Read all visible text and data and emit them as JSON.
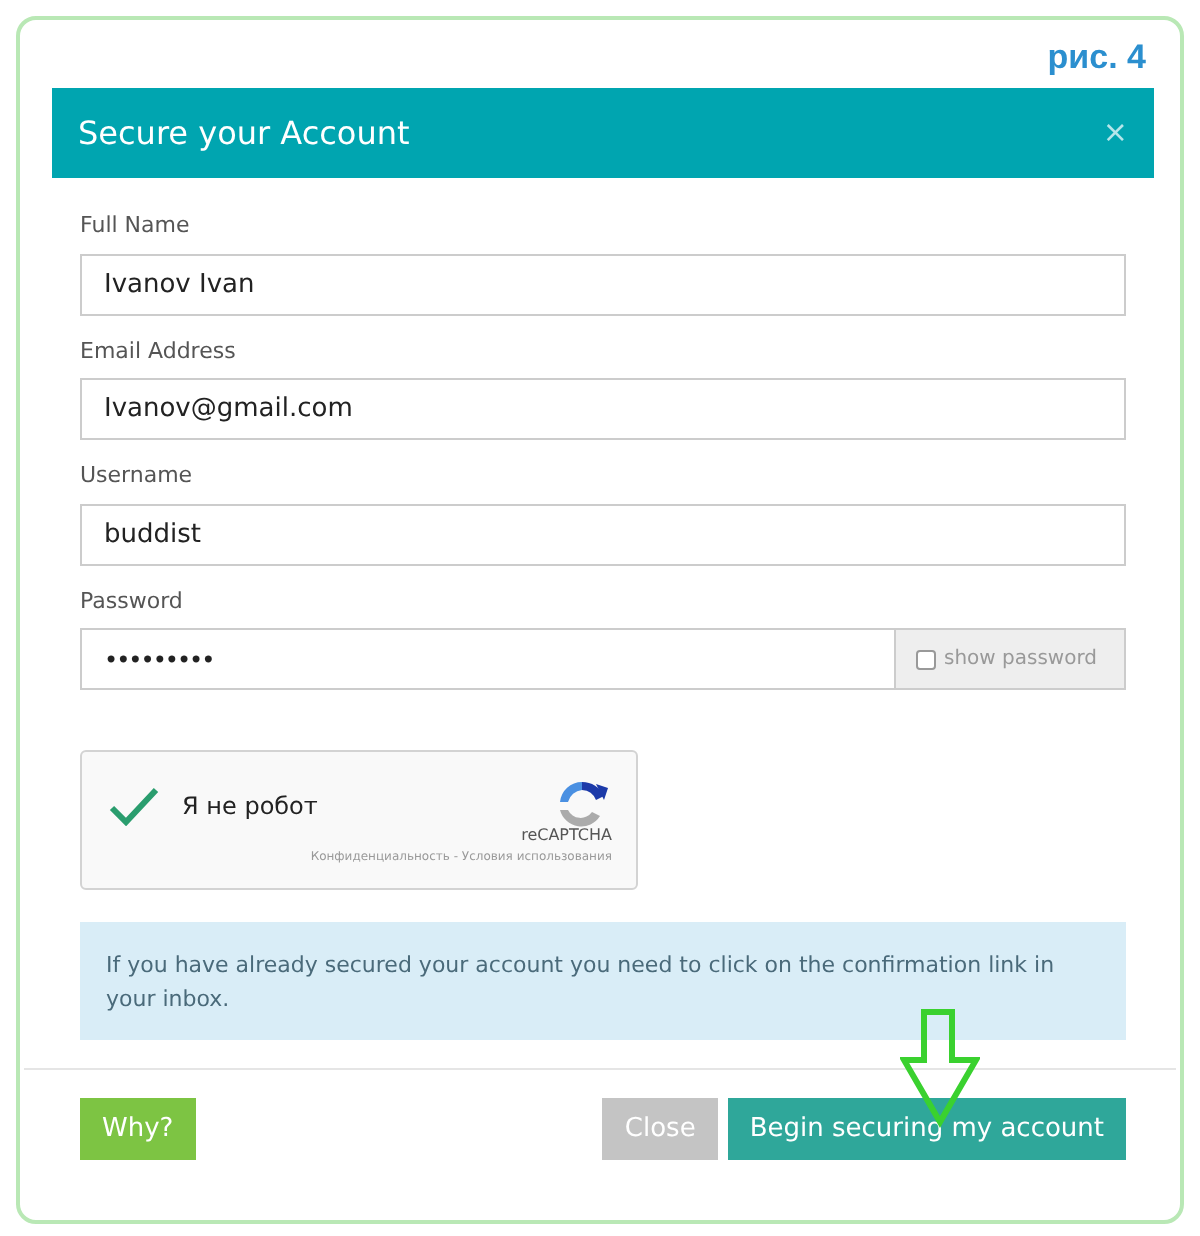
{
  "figure_label": "рис. 4",
  "dialog": {
    "title": "Secure your Account",
    "close": "×"
  },
  "fields": [
    {
      "label": "Full Name",
      "value": "Ivanov Ivan"
    },
    {
      "label": "Email Address",
      "value": "Ivanov@gmail.com"
    },
    {
      "label": "Username",
      "value": "buddist"
    },
    {
      "label": "Password",
      "value": "•••••••••",
      "addon": {
        "label": "show password",
        "checked": false
      }
    }
  ],
  "captcha": {
    "label": "Я не робот",
    "checked": true,
    "brand": "reCAPTCHA",
    "footer": "Конфиденциальность - Условия использования"
  },
  "info": "If you have already secured your account you need to click on the confirmation link in your inbox.",
  "buttons": [
    {
      "label": "Why?",
      "kind": "help"
    },
    {
      "label": "Close",
      "kind": "secondary"
    },
    {
      "label": "Begin securing my account",
      "kind": "primary"
    }
  ]
}
